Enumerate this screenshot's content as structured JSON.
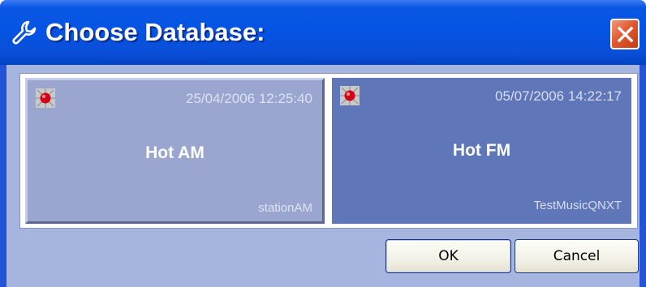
{
  "window": {
    "title": "Choose Database:",
    "title_icon": "wrench-icon",
    "close_icon": "close-icon"
  },
  "databases": [
    {
      "name": "Hot AM",
      "timestamp": "25/04/2006 12:25:40",
      "station": "stationAM",
      "icon": "red-ball-icon",
      "selected": false
    },
    {
      "name": "Hot FM",
      "timestamp": "05/07/2006 14:22:17",
      "station": "TestMusicQNXT",
      "icon": "red-ball-icon",
      "selected": true
    }
  ],
  "buttons": {
    "ok_label": "OK",
    "cancel_label": "Cancel"
  },
  "colors": {
    "titlebar": "#0554e4",
    "client_background": "#a6b5e0",
    "tile_idle": "#9aa6d0",
    "tile_selected": "#5f76b8",
    "close_button": "#e2592f"
  }
}
